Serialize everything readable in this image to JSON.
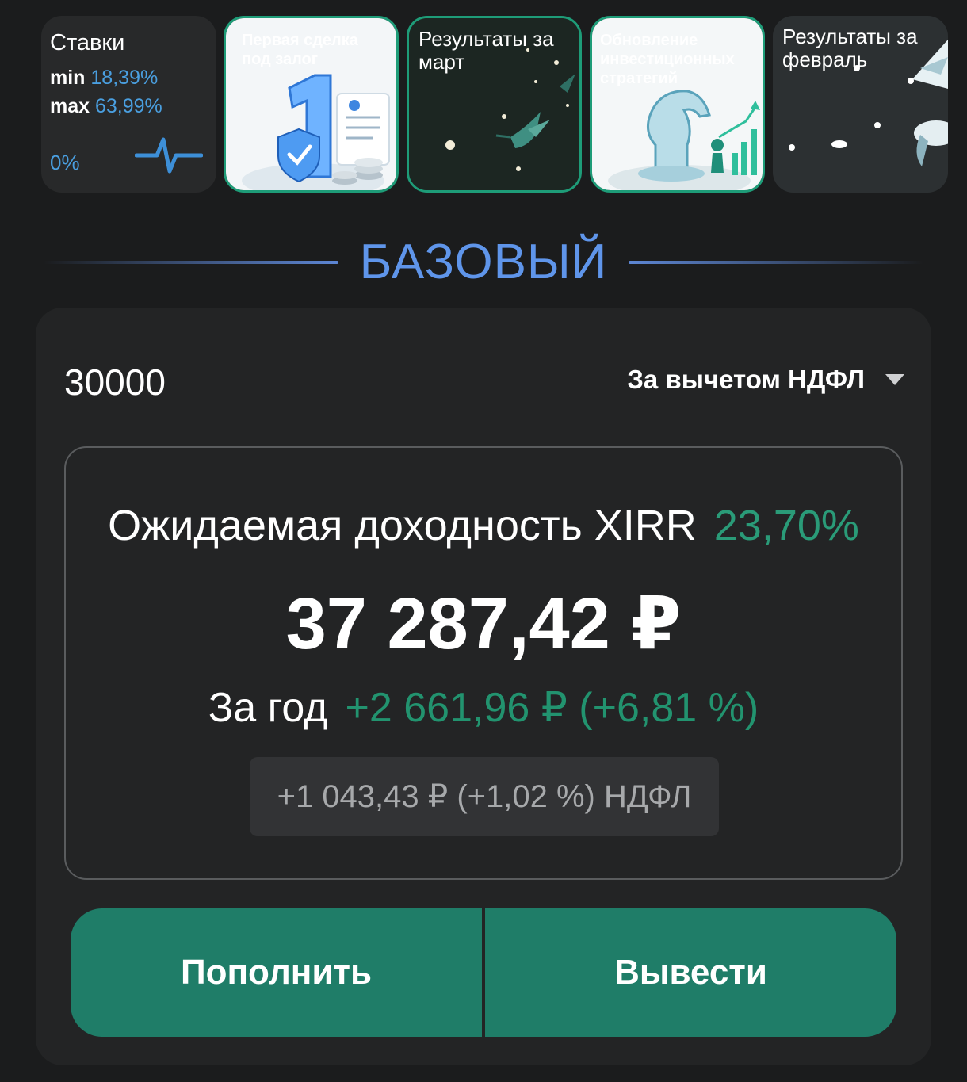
{
  "stories": {
    "rates": {
      "title": "Ставки",
      "min_label": "min",
      "min_value": "18,39%",
      "max_label": "max",
      "max_value": "63,99%",
      "zero": "0%",
      "icon": "pulse-icon"
    },
    "items": [
      {
        "title": "Первая сделка под залог",
        "icon": "number-one-shield-icon",
        "is_new": true
      },
      {
        "title": "Результаты за март",
        "icon": "hummingbird-icon",
        "is_new": true
      },
      {
        "title": "Обновление инвестиционных стратегий",
        "icon": "chess-knight-icon",
        "is_new": true
      },
      {
        "title": "Результаты за февраль",
        "icon": "bird-icon",
        "is_new": false
      }
    ]
  },
  "section_title": "БАЗОВЫЙ",
  "calculator": {
    "amount": "30000",
    "tax_mode": "За вычетом НДФЛ",
    "xirr_label": "Ожидаемая доходность XIRR",
    "xirr_value": "23,70%",
    "total": "37 287,42 ₽",
    "year_label": "За год",
    "year_change": "+2 661,96 ₽ (+6,81 %)",
    "ndfl": "+1 043,43 ₽ (+1,02 %) НДФЛ"
  },
  "actions": {
    "deposit": "Пополнить",
    "withdraw": "Вывести"
  },
  "colors": {
    "accent_blue": "#5f95ea",
    "accent_green": "#22936f",
    "button_green": "#1f7d68",
    "story_ring": "#1e9c78"
  }
}
